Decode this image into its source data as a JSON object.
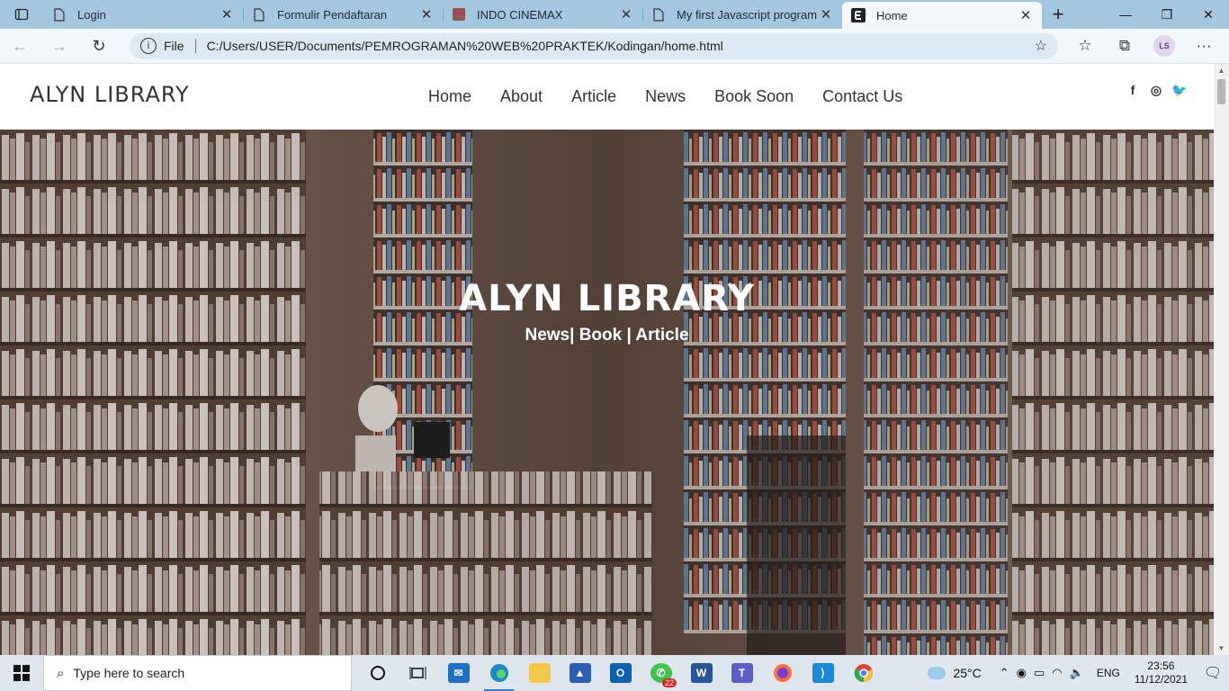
{
  "browser": {
    "tabs": [
      {
        "title": "Login",
        "icon": "page-icon"
      },
      {
        "title": "Formulir Pendaftaran",
        "icon": "page-icon"
      },
      {
        "title": "INDO CINEMAX",
        "icon": "cinema-favicon"
      },
      {
        "title": "My first Javascript program",
        "icon": "page-icon"
      },
      {
        "title": "Home",
        "icon": "elementor-favicon",
        "active": true
      }
    ],
    "address": {
      "protocol_label": "File",
      "url": "C:/Users/USER/Documents/PEMROGRAMAN%20WEB%20PRAKTEK/Kodingan/home.html"
    },
    "profile_initials": "LS"
  },
  "site": {
    "logo": "ALYN LIBRARY",
    "menu": [
      "Home",
      "About",
      "Article",
      "News",
      "Book Soon",
      "Contact Us"
    ],
    "social": {
      "facebook": "f",
      "instagram": "◎",
      "twitter": "🐦"
    },
    "hero": {
      "title": "ALYN LIBRARY",
      "subtitle": "News| Book | Article"
    }
  },
  "taskbar": {
    "search_placeholder": "Type here to search",
    "whatsapp_badge": "22",
    "weather": "25°C",
    "language": "ENG",
    "time": "23:56",
    "date": "11/12/2021"
  }
}
